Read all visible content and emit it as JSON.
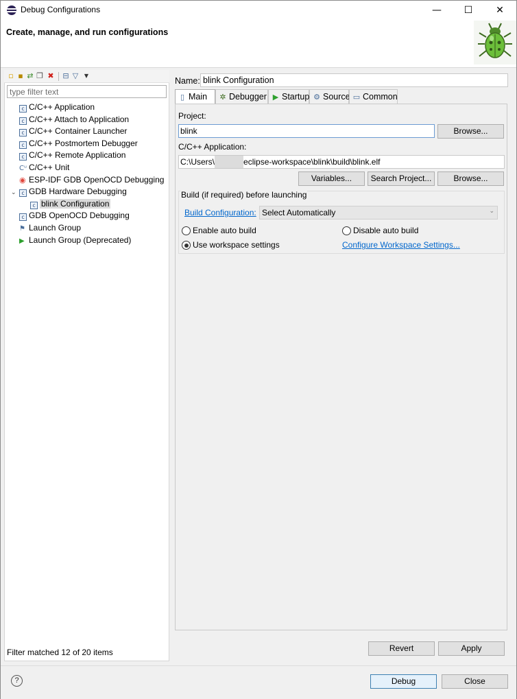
{
  "window": {
    "title": "Debug Configurations",
    "minimize_glyph": "—",
    "maximize_glyph": "☐",
    "close_glyph": "✕"
  },
  "banner": {
    "title": "Create, manage, and run configurations"
  },
  "toolbar": {
    "icons": [
      "new-configuration-icon",
      "new-prototype-icon",
      "export-icon",
      "duplicate-icon",
      "delete-icon",
      "collapse-all-icon",
      "filter-icon",
      "view-menu-icon"
    ]
  },
  "filter": {
    "placeholder": "type filter text"
  },
  "tree": {
    "items": [
      {
        "label": "C/C++ Application",
        "icon": "c-config-icon"
      },
      {
        "label": "C/C++ Attach to Application",
        "icon": "c-config-icon"
      },
      {
        "label": "C/C++ Container Launcher",
        "icon": "c-config-icon"
      },
      {
        "label": "C/C++ Postmortem Debugger",
        "icon": "c-config-icon"
      },
      {
        "label": "C/C++ Remote Application",
        "icon": "c-config-icon"
      },
      {
        "label": "C/C++ Unit",
        "icon": "c-unit-icon"
      },
      {
        "label": "ESP-IDF GDB OpenOCD Debugging",
        "icon": "esp-idf-icon"
      },
      {
        "label": "GDB Hardware Debugging",
        "icon": "c-config-icon",
        "expanded": true
      },
      {
        "label": "blink Configuration",
        "icon": "c-config-icon",
        "selected": true
      },
      {
        "label": "GDB OpenOCD Debugging",
        "icon": "c-config-icon"
      },
      {
        "label": "Launch Group",
        "icon": "launch-group-icon"
      },
      {
        "label": "Launch Group (Deprecated)",
        "icon": "run-icon"
      }
    ]
  },
  "status": "Filter matched 12 of 20 items",
  "name": {
    "label": "Name:",
    "value": "blink Configuration"
  },
  "tabs": [
    {
      "label": "Main",
      "icon": "main-tab-icon",
      "active": true
    },
    {
      "label": "Debugger",
      "icon": "debugger-tab-icon"
    },
    {
      "label": "Startup",
      "icon": "startup-tab-icon"
    },
    {
      "label": "Source",
      "icon": "source-tab-icon"
    },
    {
      "label": "Common",
      "icon": "common-tab-icon"
    }
  ],
  "main": {
    "project_label": "Project:",
    "project_value": "blink",
    "browse_label": "Browse...",
    "app_label": "C/C++ Application:",
    "app_value_prefix": "C:\\Users\\",
    "app_value_suffix": "eclipse-workspace\\blink\\build\\blink.elf",
    "variables_label": "Variables...",
    "search_project_label": "Search Project...",
    "browse2_label": "Browse...",
    "build_group_title": "Build (if required) before launching",
    "build_config_link": "Build Configuration:",
    "build_config_value": "Select Automatically",
    "enable_auto_build": "Enable auto build",
    "disable_auto_build": "Disable auto build",
    "use_workspace_settings": "Use workspace settings",
    "configure_workspace_link": "Configure Workspace Settings...",
    "selected_radio": "use_workspace_settings"
  },
  "buttons": {
    "revert": "Revert",
    "apply": "Apply",
    "debug": "Debug",
    "close": "Close",
    "help": "?"
  },
  "colors": {
    "link": "#0066cc",
    "focus": "#6b9bd2",
    "bug_green": "#6cbf3a"
  }
}
